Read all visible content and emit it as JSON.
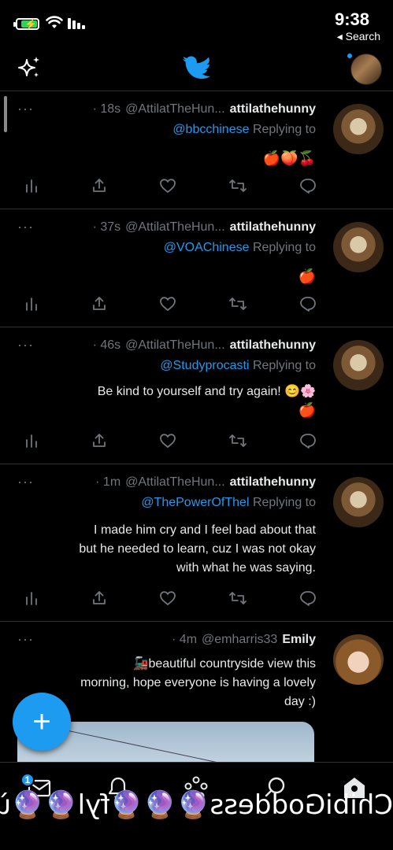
{
  "status_bar": {
    "time": "9:38",
    "back_label": "◂ Search",
    "battery_icon": "battery-charging-icon",
    "wifi_icon": "wifi-icon",
    "signal_icon": "cellular-signal-icon"
  },
  "header": {
    "logo_icon": "twitter-bird-icon",
    "sparkle_icon": "sparkle-icon"
  },
  "colors": {
    "accent": "#1d9bf0",
    "background": "#000000",
    "muted": "#71767b",
    "divider": "#2f3336"
  },
  "tweets": [
    {
      "name": "attilathehunny",
      "handle": "@AttilatTheHun...",
      "time": "· 18s",
      "reply_prefix": "Replying to",
      "reply_handle": "@bbcchinese",
      "text": "🍎🍑🍒"
    },
    {
      "name": "attilathehunny",
      "handle": "@AttilatTheHun...",
      "time": "· 37s",
      "reply_prefix": "Replying to",
      "reply_handle": "@VOAChinese",
      "text": "🍎"
    },
    {
      "name": "attilathehunny",
      "handle": "@AttilatTheHun...",
      "time": "· 46s",
      "reply_prefix": "Replying to",
      "reply_handle": "@Studyprocasti",
      "text_line1": "Be kind to yourself and try again! 😊🌸",
      "text_line2": "🍎"
    },
    {
      "name": "attilathehunny",
      "handle": "@AttilatTheHun...",
      "time": "· 1m",
      "reply_prefix": "Replying to",
      "reply_handle": "@ThePowerOfThel",
      "text_line1": "I made him cry and I feel bad about that",
      "text_line2": "but he needed to learn, cuz I was not okay",
      "text_line3": "with what he was saying."
    },
    {
      "name": "Emily",
      "handle": "@emharris33",
      "time": "· 4m",
      "text_line1": "🚂beautiful countryside view this",
      "text_line2": "morning, hope everyone is having a lovely",
      "text_line3": "day :)"
    }
  ],
  "more_label": "···",
  "compose_label": "+",
  "bottom_nav": {
    "items": [
      "home-icon",
      "search-icon",
      "spaces-icon",
      "notifications-icon",
      "messages-icon"
    ],
    "messages_badge": "1"
  },
  "footer_text": "ChibiGoddess🔮🔮🔮fyl🔮🔮ù"
}
